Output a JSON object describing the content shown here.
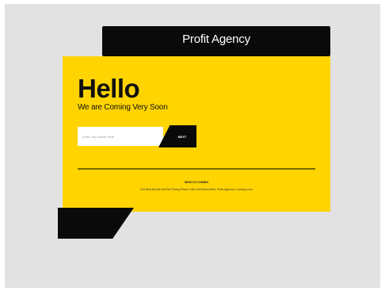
{
  "header": {
    "title": "Profit Agency"
  },
  "hero": {
    "heading": "Hello",
    "subtitle": "We are Coming Very Soon"
  },
  "signup": {
    "placeholder": "Enter Your Name Here",
    "button_label": "NEXT"
  },
  "info": {
    "heading": "WHAT IS COMING",
    "text": "Get Best And Be Not Bet Timing Peace Calm and Remember, Profit Agency is coming soon"
  },
  "colors": {
    "accent": "#ffd400",
    "dark": "#0a0a0a",
    "background": "#e2e2e2"
  }
}
